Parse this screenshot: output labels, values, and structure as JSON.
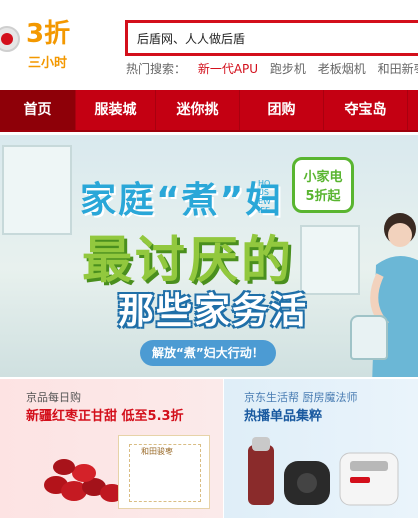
{
  "logo": {
    "discount": "3折",
    "sub": "三小时"
  },
  "search": {
    "value": "后盾网、人人做后盾"
  },
  "hot_searches": {
    "label": "热门搜索：",
    "items": [
      "新一代APU",
      "跑步机",
      "老板烟机",
      "和田新枣"
    ]
  },
  "nav": {
    "items": [
      "首页",
      "服装城",
      "迷你挑",
      "团购",
      "夺宝岛"
    ],
    "active": 0
  },
  "banner": {
    "title1": "家庭“煮”妇",
    "vertical": "HOUSEWIFE",
    "title2": "最讨厌的",
    "title3": "那些家务活",
    "tagline": "解放“煮”妇大行动！",
    "badge_line1": "小家电",
    "badge_line2": "5折起"
  },
  "promos": [
    {
      "label": "京品每日购",
      "title": "新疆红枣正甘甜 低至5.3折",
      "box_label": "和田骏枣"
    },
    {
      "label": "京东生活帮 厨房魔法师",
      "title": "热播单品集粹"
    }
  ],
  "colors": {
    "brand_red": "#d30f1b",
    "nav_red": "#c40012",
    "logo_orange": "#f39800"
  }
}
